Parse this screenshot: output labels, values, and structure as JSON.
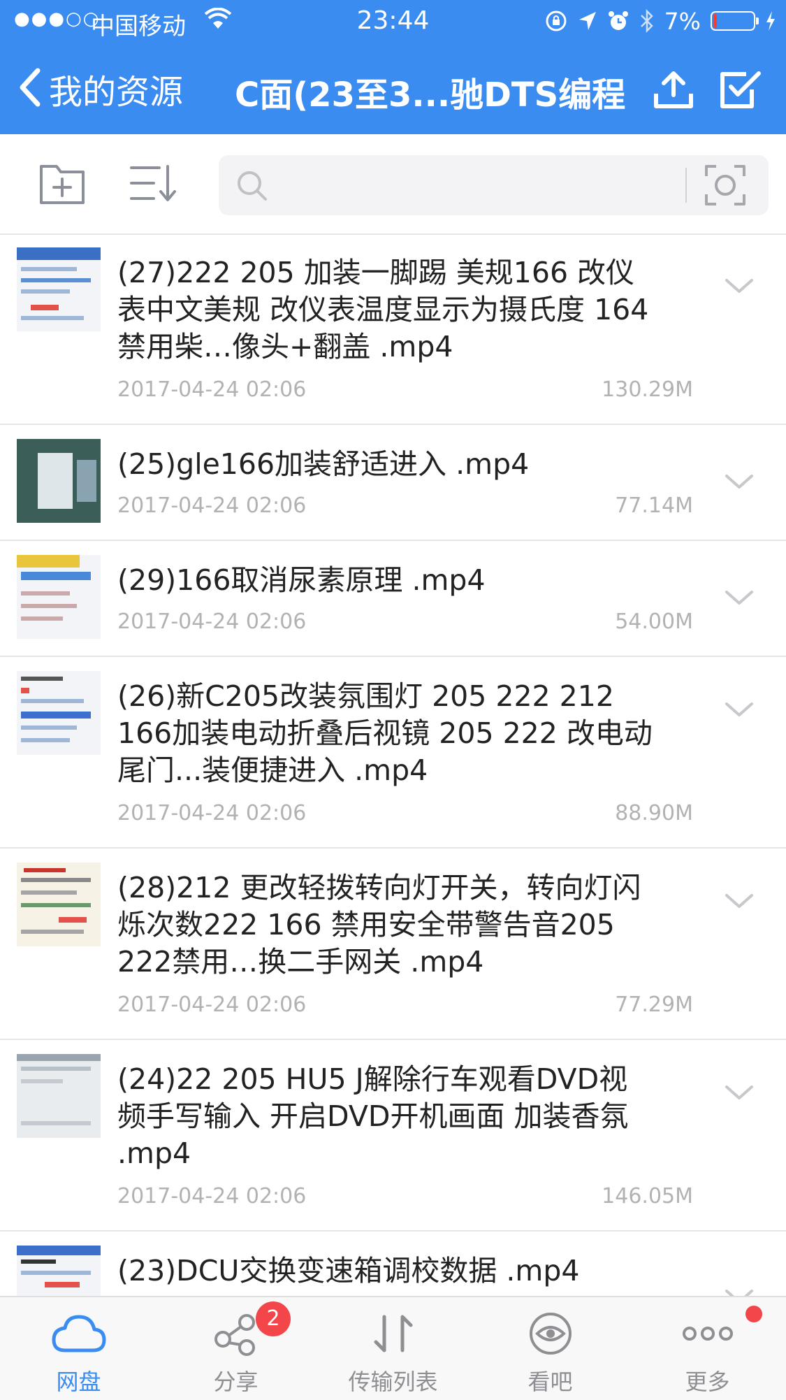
{
  "status_bar": {
    "signal": "●●●○○",
    "carrier": "中国移动",
    "time": "23:44",
    "battery_percent": "7%",
    "icons": [
      "wifi-icon",
      "orientation-lock-icon",
      "location-icon",
      "alarm-icon",
      "bluetooth-icon",
      "charging-icon"
    ]
  },
  "nav": {
    "back_label": "我的资源",
    "title": "C面(23至3...驰DTS编程",
    "icons": [
      "chevron-left-icon",
      "upload-icon",
      "checkbox-icon"
    ]
  },
  "toolbar": {
    "icons": [
      "new-folder-icon",
      "sort-icon",
      "search-icon",
      "scan-icon"
    ],
    "search_placeholder": ""
  },
  "files": [
    {
      "name": "(27)222 205 加装一脚踢 美规166 改仪表中文美规 改仪表温度显示为摄氏度 164禁用柴…像头+翻盖 .mp4",
      "date": "2017-04-24 02:06",
      "size": "130.29M"
    },
    {
      "name": "(25)gle166加装舒适进入 .mp4",
      "date": "2017-04-24 02:06",
      "size": "77.14M"
    },
    {
      "name": "(29)166取消尿素原理 .mp4",
      "date": "2017-04-24 02:06",
      "size": "54.00M"
    },
    {
      "name": "(26)新C205改装氛围灯 205 222 212 166加装电动折叠后视镜 205 222 改电动尾门...装便捷进入 .mp4",
      "date": "2017-04-24 02:06",
      "size": "88.90M"
    },
    {
      "name": "(28)212 更改轻拨转向灯开关，转向灯闪烁次数222 166 禁用安全带警告音205 222禁用…换二手网关 .mp4",
      "date": "2017-04-24 02:06",
      "size": "77.29M"
    },
    {
      "name": "(24)22 205 HU5 J解除行车观看DVD视频手写输入 开启DVD开机画面 加装香氛 .mp4",
      "date": "2017-04-24 02:06",
      "size": "146.05M"
    },
    {
      "name": "(23)DCU交换变速箱调校数据 .mp4",
      "date": "",
      "size": ""
    }
  ],
  "tabs": [
    {
      "label": "网盘",
      "icon": "cloud-icon",
      "active": true
    },
    {
      "label": "分享",
      "icon": "share-icon",
      "badge": "2"
    },
    {
      "label": "传输列表",
      "icon": "transfer-icon"
    },
    {
      "label": "看吧",
      "icon": "eye-icon"
    },
    {
      "label": "更多",
      "icon": "more-icon",
      "dot": true
    }
  ],
  "colors": {
    "accent": "#3b8cf1",
    "badge": "#f2464a",
    "battery_low": "#ff3b30",
    "meta_text": "#b2b2b2"
  }
}
